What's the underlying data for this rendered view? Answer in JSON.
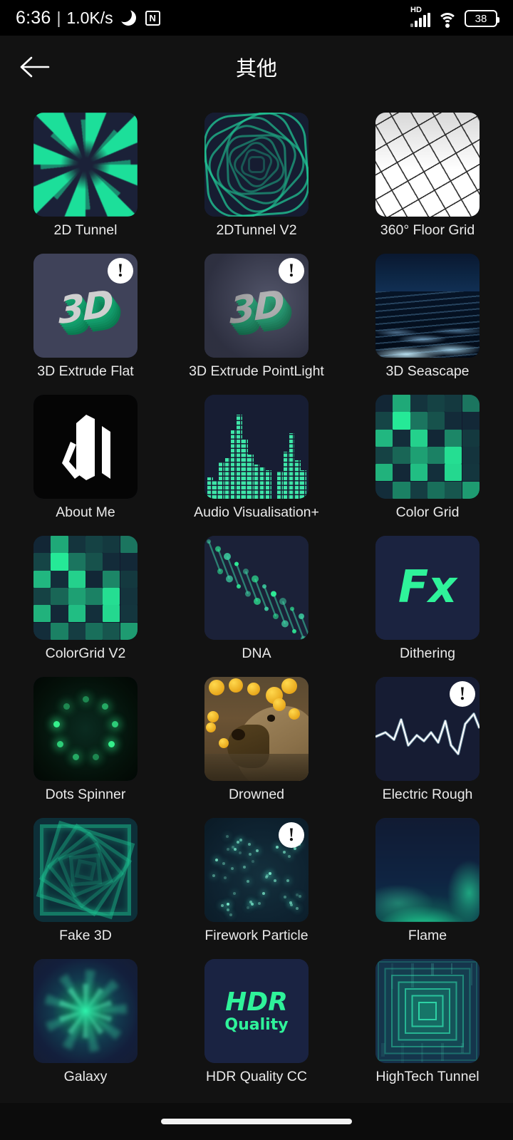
{
  "status_bar": {
    "time": "6:36",
    "separator": "|",
    "network_speed": "1.0K/s",
    "dnd_icon": "crescent-moon-icon",
    "nfc_icon": "nfc-icon",
    "nfc_glyph": "N",
    "hd_label": "HD",
    "signal_icon": "signal-bars-icon",
    "wifi_icon": "wifi-icon",
    "battery_level": "38"
  },
  "app_bar": {
    "back_icon": "back-arrow-icon",
    "title": "其他"
  },
  "grid": {
    "items": [
      {
        "label": "2D Tunnel",
        "art": "tunnel",
        "badge": false
      },
      {
        "label": "2DTunnel V2",
        "art": "tunnel2",
        "badge": false
      },
      {
        "label": "360° Floor Grid",
        "art": "floor",
        "badge": false
      },
      {
        "label": "3D Extrude Flat",
        "art": "extrude",
        "badge": true,
        "badge_glyph": "!"
      },
      {
        "label": "3D Extrude PointLight",
        "art": "extrude2",
        "badge": true,
        "badge_glyph": "!"
      },
      {
        "label": "3D Seascape",
        "art": "seascape",
        "badge": false
      },
      {
        "label": "About Me",
        "art": "about",
        "badge": false
      },
      {
        "label": "Audio Visualisation+",
        "art": "audio",
        "badge": false
      },
      {
        "label": "Color Grid",
        "art": "colorgrid",
        "badge": false
      },
      {
        "label": "ColorGrid V2",
        "art": "colorgrid2",
        "badge": false
      },
      {
        "label": "DNA",
        "art": "dna",
        "badge": false
      },
      {
        "label": "Dithering",
        "art": "fx",
        "badge": false,
        "art_text": "Fx"
      },
      {
        "label": "Dots Spinner",
        "art": "dots",
        "badge": false
      },
      {
        "label": "Drowned",
        "art": "capybara",
        "badge": false
      },
      {
        "label": "Electric Rough",
        "art": "electric",
        "badge": true,
        "badge_glyph": "!"
      },
      {
        "label": "Fake 3D",
        "art": "fake3d",
        "badge": false
      },
      {
        "label": "Firework Particle",
        "art": "firework",
        "badge": true,
        "badge_glyph": "!"
      },
      {
        "label": "Flame",
        "art": "flame",
        "badge": false
      },
      {
        "label": "Galaxy",
        "art": "galaxy",
        "badge": false
      },
      {
        "label": "HDR Quality CC",
        "art": "hdr",
        "badge": false,
        "art_text": "HDR",
        "art_text2": "Quality"
      },
      {
        "label": "HighTech Tunnel",
        "art": "hightech",
        "badge": false
      }
    ]
  },
  "nav_bar": {
    "gesture_pill": "home-gesture-pill"
  },
  "colors": {
    "background": "#121212",
    "accent_green": "#2ff39a",
    "tile_navy": "#1b2138",
    "extrude_slate": "#3f4259",
    "text": "#eaeaea"
  }
}
